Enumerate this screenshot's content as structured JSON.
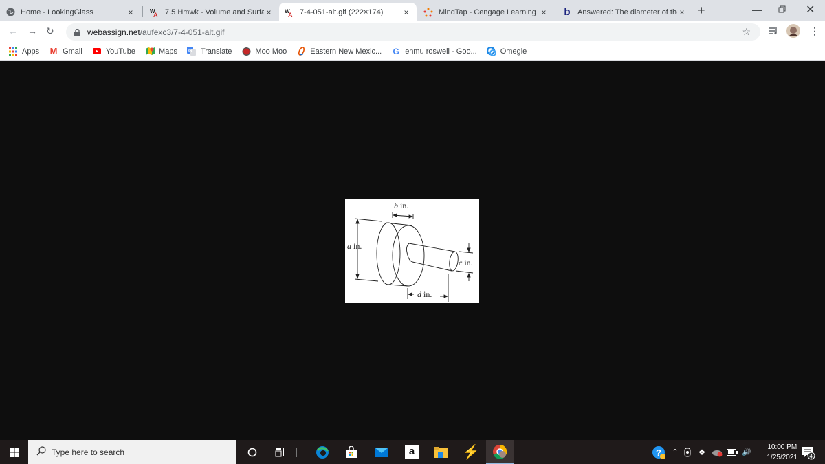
{
  "browser": {
    "tabs": [
      {
        "title": "Home - LookingGlass",
        "favicon": "globe-icon",
        "active": false
      },
      {
        "title": "7.5 Hmwk - Volume and Surfac",
        "favicon": "webassign-icon",
        "active": false
      },
      {
        "title": "7-4-051-alt.gif (222×174)",
        "favicon": "webassign-icon",
        "active": true
      },
      {
        "title": "MindTap - Cengage Learning",
        "favicon": "mindtap-icon",
        "active": false
      },
      {
        "title": "Answered: The diameter of the",
        "favicon": "bartleby-icon",
        "active": false
      }
    ],
    "new_tab_label": "+",
    "close_label": "×",
    "url_host": "webassign.net",
    "url_path": "/aufexc3/7-4-051-alt.gif",
    "bookmarks": [
      {
        "label": "Apps",
        "icon": "apps-grid-icon"
      },
      {
        "label": "Gmail",
        "icon": "gmail-icon"
      },
      {
        "label": "YouTube",
        "icon": "youtube-icon"
      },
      {
        "label": "Maps",
        "icon": "maps-icon"
      },
      {
        "label": "Translate",
        "icon": "translate-icon"
      },
      {
        "label": "Moo Moo",
        "icon": "moomoo-icon"
      },
      {
        "label": "Eastern New Mexic...",
        "icon": "enmu-icon"
      },
      {
        "label": "enmu roswell - Goo...",
        "icon": "google-icon"
      },
      {
        "label": "Omegle",
        "icon": "omegle-icon"
      }
    ]
  },
  "figure": {
    "label_b": "b",
    "label_a": "a",
    "label_c": "c",
    "label_d": "d",
    "unit": " in."
  },
  "taskbar": {
    "search_placeholder": "Type here to search",
    "time": "10:00 PM",
    "date": "1/25/2021",
    "notification_count": "4",
    "amazon_letter": "a"
  }
}
